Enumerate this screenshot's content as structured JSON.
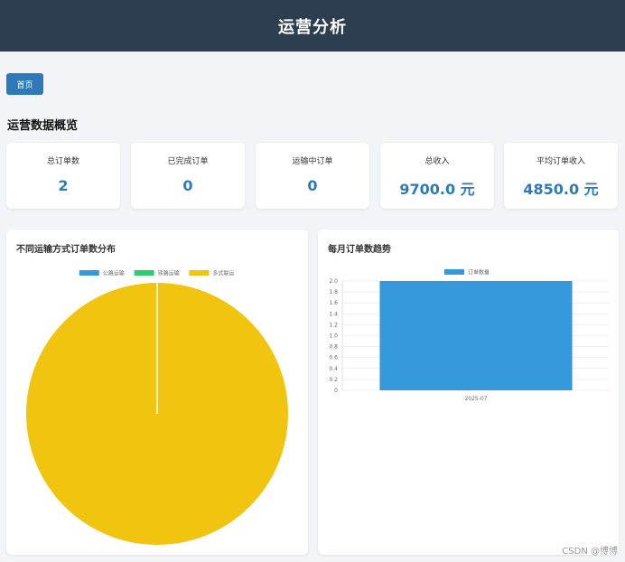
{
  "header": {
    "title": "运营分析"
  },
  "nav": {
    "home_label": "首页"
  },
  "overview": {
    "title": "运营数据概览",
    "cards": [
      {
        "label": "总订单数",
        "value": "2"
      },
      {
        "label": "已完成订单",
        "value": "0"
      },
      {
        "label": "运输中订单",
        "value": "0"
      },
      {
        "label": "总收入",
        "value": "9700.0 元"
      },
      {
        "label": "平均订单收入",
        "value": "4850.0 元"
      }
    ]
  },
  "colors": {
    "header_bg": "#2c3e50",
    "accent": "#2e7ab8",
    "road": "#3498db",
    "rail": "#2ecc71",
    "multimodal": "#f1c40f",
    "bar": "#3498db"
  },
  "chart_data": [
    {
      "type": "pie",
      "title": "不同运输方式订单数分布",
      "categories": [
        "公路运输",
        "铁路运输",
        "多式联运"
      ],
      "values": [
        0,
        0,
        2
      ],
      "colors": [
        "#3498db",
        "#2ecc71",
        "#f1c40f"
      ],
      "legend": "top"
    },
    {
      "type": "bar",
      "title": "每月订单数趋势",
      "categories": [
        "2025-07"
      ],
      "series": [
        {
          "name": "订单数量",
          "values": [
            2
          ]
        }
      ],
      "ylim": [
        0,
        2.0
      ],
      "yticks": [
        "2.0",
        "1.8",
        "1.6",
        "1.4",
        "1.2",
        "1.0",
        "0.8",
        "0.6",
        "0.4",
        "0.2",
        "0"
      ],
      "grid": true,
      "legend": "top"
    }
  ],
  "watermark": "CSDN @博博"
}
